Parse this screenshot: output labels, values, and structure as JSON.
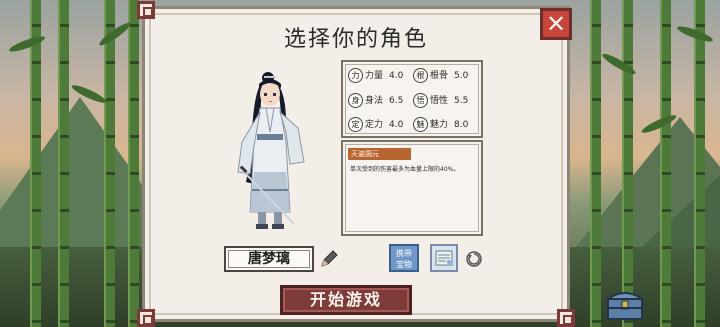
{
  "title": "选择你的角色",
  "close_label": "✕",
  "character": {
    "name": "唐梦璃"
  },
  "stats": [
    {
      "icon": "力",
      "label": "力量",
      "value": "4.0"
    },
    {
      "icon": "根",
      "label": "根骨",
      "value": "5.0"
    },
    {
      "icon": "身",
      "label": "身法",
      "value": "6.5"
    },
    {
      "icon": "悟",
      "label": "悟性",
      "value": "5.5"
    },
    {
      "icon": "定",
      "label": "定力",
      "value": "4.0"
    },
    {
      "icon": "魅",
      "label": "魅力",
      "value": "8.0"
    }
  ],
  "skill": {
    "name": "天姿圆元",
    "description": "单次受到的伤害最多为血量上限的40%。"
  },
  "buttons": {
    "treasure_label_line1": "携带",
    "treasure_label_line2": "宝物",
    "start_label": "开始游戏"
  },
  "colors": {
    "accent": "#7d3b3a",
    "close": "#c8453c",
    "skill_tag": "#b96532",
    "treasure": "#6f97c9"
  },
  "icons": [
    "close-icon",
    "pencil-icon",
    "refresh-icon",
    "chest-icon",
    "scroll-item-icon"
  ]
}
